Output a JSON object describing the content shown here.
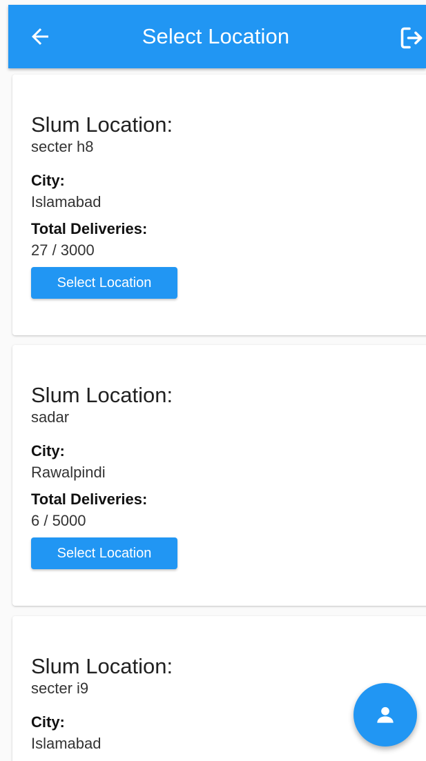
{
  "appbar": {
    "title": "Select Location",
    "back_icon": "arrow-left-icon",
    "logout_icon": "logout-icon",
    "color": "#2196f3"
  },
  "locations": [
    {
      "slum_heading": "Slum Location:",
      "slum_value": "secter h8",
      "city_label": "City:",
      "city_value": "Islamabad",
      "deliveries_label": "Total Deliveries:",
      "deliveries_value": "27 / 3000",
      "button_label": "Select Location"
    },
    {
      "slum_heading": "Slum Location:",
      "slum_value": "sadar",
      "city_label": "City:",
      "city_value": "Rawalpindi",
      "deliveries_label": "Total Deliveries:",
      "deliveries_value": "6 / 5000",
      "button_label": "Select Location"
    },
    {
      "slum_heading": "Slum Location:",
      "slum_value": "secter i9",
      "city_label": "City:",
      "city_value": "Islamabad"
    }
  ],
  "fab": {
    "icon": "person-icon"
  }
}
